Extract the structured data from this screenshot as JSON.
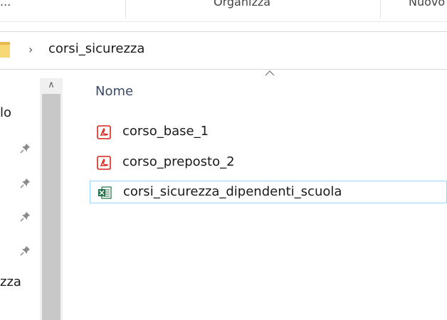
{
  "ribbon": {
    "items": [
      "...",
      "Organizza",
      "Nuovo"
    ]
  },
  "address_bar": {
    "path": [
      "corsi_sicurezza"
    ]
  },
  "nav_pane": {
    "items": [
      {
        "label": "lo",
        "pinned": false
      },
      {
        "label": "",
        "pinned": true
      },
      {
        "label": "",
        "pinned": true
      },
      {
        "label": "",
        "pinned": true
      },
      {
        "label": "",
        "pinned": true
      },
      {
        "label": "zza",
        "pinned": false
      }
    ]
  },
  "file_list": {
    "column_name": "Nome",
    "files": [
      {
        "name": "corso_base_1",
        "type": "pdf",
        "icon": "pdf-icon",
        "selected": false
      },
      {
        "name": "corso_preposto_2",
        "type": "pdf",
        "icon": "pdf-icon",
        "selected": false
      },
      {
        "name": "corsi_sicurezza_dipendenti_scuola",
        "type": "excel",
        "icon": "excel-icon",
        "selected": true
      }
    ]
  },
  "colors": {
    "selection_border": "#99d1ff",
    "pdf_red": "#d9221c",
    "excel_green": "#1e7145",
    "folder_yellow": "#f8d775",
    "column_header": "#3a4a66"
  }
}
